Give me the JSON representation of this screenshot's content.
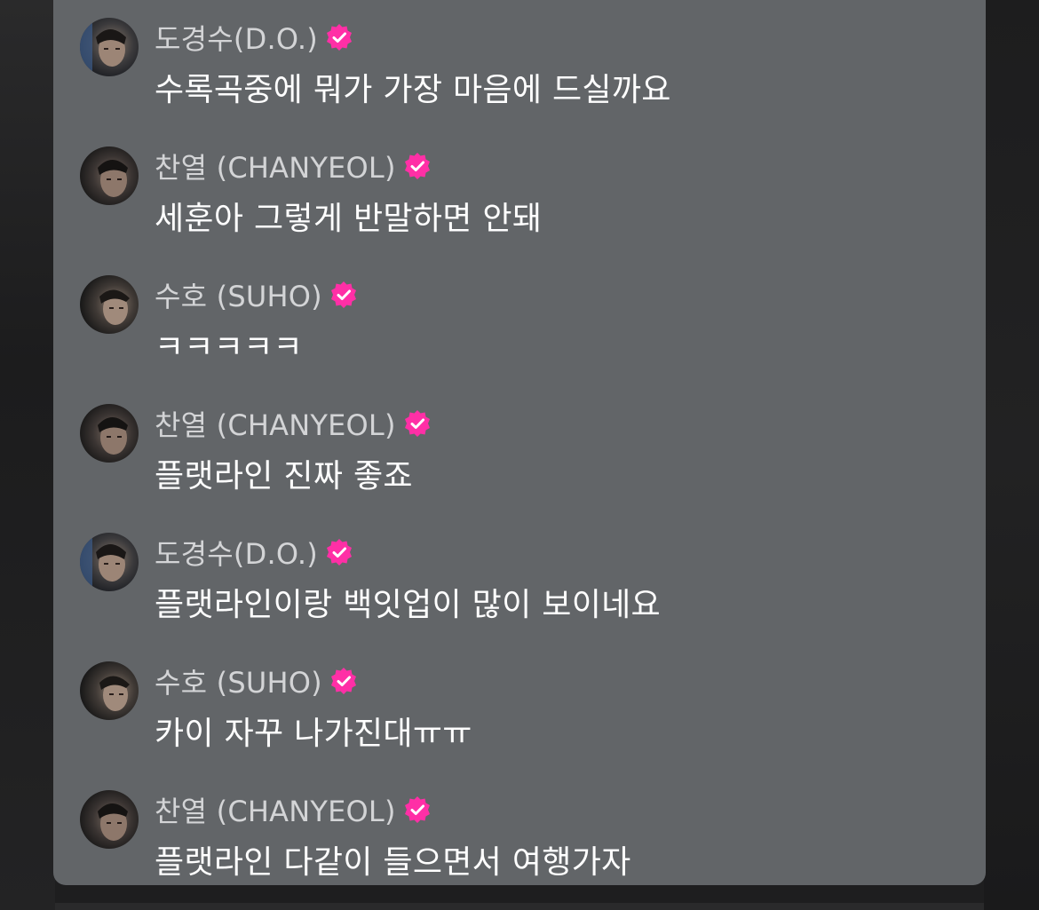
{
  "colors": {
    "panel_bg": "#626568",
    "page_bg": "#1e1e1f",
    "name_text": "#d3d4d6",
    "message_text": "#ffffff",
    "verified_badge": "#ff2fa6"
  },
  "messages": [
    {
      "author": "도경수(D.O.)",
      "verified": true,
      "avatar": "do-avatar",
      "text": "수록곡중에 뭐가 가장 마음에 드실까요"
    },
    {
      "author": "찬열 (CHANYEOL)",
      "verified": true,
      "avatar": "chanyeol-avatar",
      "text": "세훈아 그렇게 반말하면 안돼"
    },
    {
      "author": "수호 (SUHO)",
      "verified": true,
      "avatar": "suho-avatar",
      "text": "ㅋㅋㅋㅋㅋ"
    },
    {
      "author": "찬열 (CHANYEOL)",
      "verified": true,
      "avatar": "chanyeol-avatar",
      "text": "플랫라인 진짜 좋죠"
    },
    {
      "author": "도경수(D.O.)",
      "verified": true,
      "avatar": "do-avatar",
      "text": "플랫라인이랑 백잇업이 많이 보이네요"
    },
    {
      "author": "수호 (SUHO)",
      "verified": true,
      "avatar": "suho-avatar",
      "text": "카이 자꾸 나가진대ㅠㅠ"
    },
    {
      "author": "찬열 (CHANYEOL)",
      "verified": true,
      "avatar": "chanyeol-avatar",
      "text": "플랫라인 다같이 들으면서 여행가자"
    }
  ]
}
